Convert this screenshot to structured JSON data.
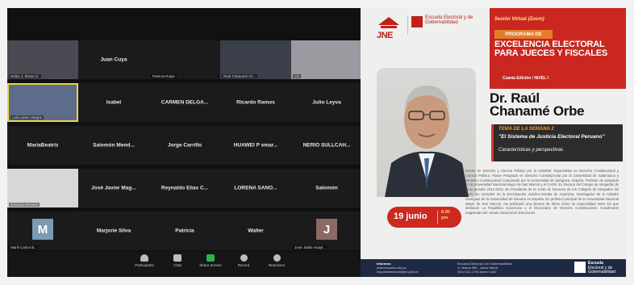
{
  "gallery": {
    "tiles": [
      {
        "name": "",
        "tag": "Helen J. Rosto G."
      },
      {
        "name": "Juan Cuya",
        "tag": ""
      },
      {
        "name": "",
        "tag": "Patricia Rojas"
      },
      {
        "name": "",
        "tag": "Raúl Chanamé Or..."
      },
      {
        "name": "",
        "tag": "LG"
      },
      {
        "name": "",
        "tag": "Luis Lanko Vargas"
      },
      {
        "name": "Isabel",
        "tag": ""
      },
      {
        "name": "CARMEN DELGA...",
        "tag": ""
      },
      {
        "name": "Ricardo Ramos",
        "tag": ""
      },
      {
        "name": "Julio Leyva",
        "tag": ""
      },
      {
        "name": "MariaBeatriz",
        "tag": ""
      },
      {
        "name": "Salomón Mend...",
        "tag": ""
      },
      {
        "name": "Jorge Carrillo",
        "tag": ""
      },
      {
        "name": "HUAWEI P smar...",
        "tag": ""
      },
      {
        "name": "NERIO SULLCAH...",
        "tag": ""
      },
      {
        "name": "",
        "tag": "Eduardo Morales"
      },
      {
        "name": "José Javier Mag...",
        "tag": ""
      },
      {
        "name": "Reynaldo Elias C...",
        "tag": ""
      },
      {
        "name": "LORENA SANO...",
        "tag": ""
      },
      {
        "name": "Salomón",
        "tag": ""
      },
      {
        "name": "M",
        "tag": "Marili Carlos B..."
      },
      {
        "name": "Marjorie Silva",
        "tag": ""
      },
      {
        "name": "Patricia",
        "tag": ""
      },
      {
        "name": "Walter",
        "tag": ""
      },
      {
        "name": "J",
        "tag": "José Julián Huayl..."
      }
    ],
    "toolbar": [
      {
        "label": "Participants",
        "icon": "participants-icon"
      },
      {
        "label": "Chat",
        "icon": "chat-icon"
      },
      {
        "label": "Share Screen",
        "icon": "share-screen-icon"
      },
      {
        "label": "Record",
        "icon": "record-icon"
      },
      {
        "label": "Reactions",
        "icon": "reactions-icon"
      }
    ],
    "colors": {
      "active_border": "#e8d54a",
      "share_green": "#2db34a",
      "m_avatar": "#7a9bb3",
      "j_avatar": "#8a6a63"
    }
  },
  "flyer": {
    "jne": "JNE",
    "escuela": "Escuela Electoral y de Gobernabilidad",
    "session": "Sesión Virtual (Zoom)",
    "program_label": "PROGRAMA DE",
    "title_line1": "EXCELENCIA ELECTORAL",
    "title_line2": "PARA JUECES Y FISCALES",
    "edition": "Cuarta Edición / NIVEL I",
    "speaker_line1": "Dr. Raúl",
    "speaker_line2": "Chanamé Orbe",
    "topic_week": "TEMA DE LA SEMANA 2",
    "topic_title": "\"El Sistema de Justicia Electoral Peruano\"",
    "topic_sub": "Características y perspectivas",
    "date": "19 junio",
    "time_line1": "6:00",
    "time_line2": "pm",
    "bio": "Doctor en Derecho y Ciencia Política por la UNMSM. Especialista en Derecho Constitucional y Ciencia Política. Posee Posgrado en Derecho Constitucional por la Universidad de Salamanca y Derecho Constitucional Comparado por la Universidad de Zaragoza, España. Profesor de posgrado en la Universidad Nacional Mayor de San Marcos y el CAEN. Ex Decano del Colegio de Abogados de Lima periodo 2012-2013. Ex Presidente de la Junta de Decanos de los Colegios de Abogados del Perú. Su consultor de la Enciclopedia Jurídico-Omeba de Argentina, investigador de la Cátedra Garrigues de la Universidad de Navarra en España. Ex profesor principal de la Universidad Nacional Mayor de San Marcos. Ha publicado una decena de libros sobre su especialidad entre los que destacan La República Inconclusa y el Diccionario de Derecho Constitucional. Actualmente magistrado del Jurado Nacional de Elecciones.",
    "footer_info_label": "Informes:",
    "footer_info_1": "www.escuela.edu.pe",
    "footer_info_2": "escuelaelectoral@jne.gob.pe",
    "footer_addr_1": "Escuela Electoral y de Gobernabilidad",
    "footer_addr_2": "Jr. Nazca 598 - Jesús María",
    "footer_addr_3": "(511) 311-1700 anexo 1182",
    "footer_logo_1": "Escuela",
    "footer_logo_2": "Electoral y de",
    "footer_logo_3": "Gobernabilidad",
    "colors": {
      "red": "#c9271f",
      "orange": "#e27b2b",
      "navy": "#1e2a44"
    }
  }
}
